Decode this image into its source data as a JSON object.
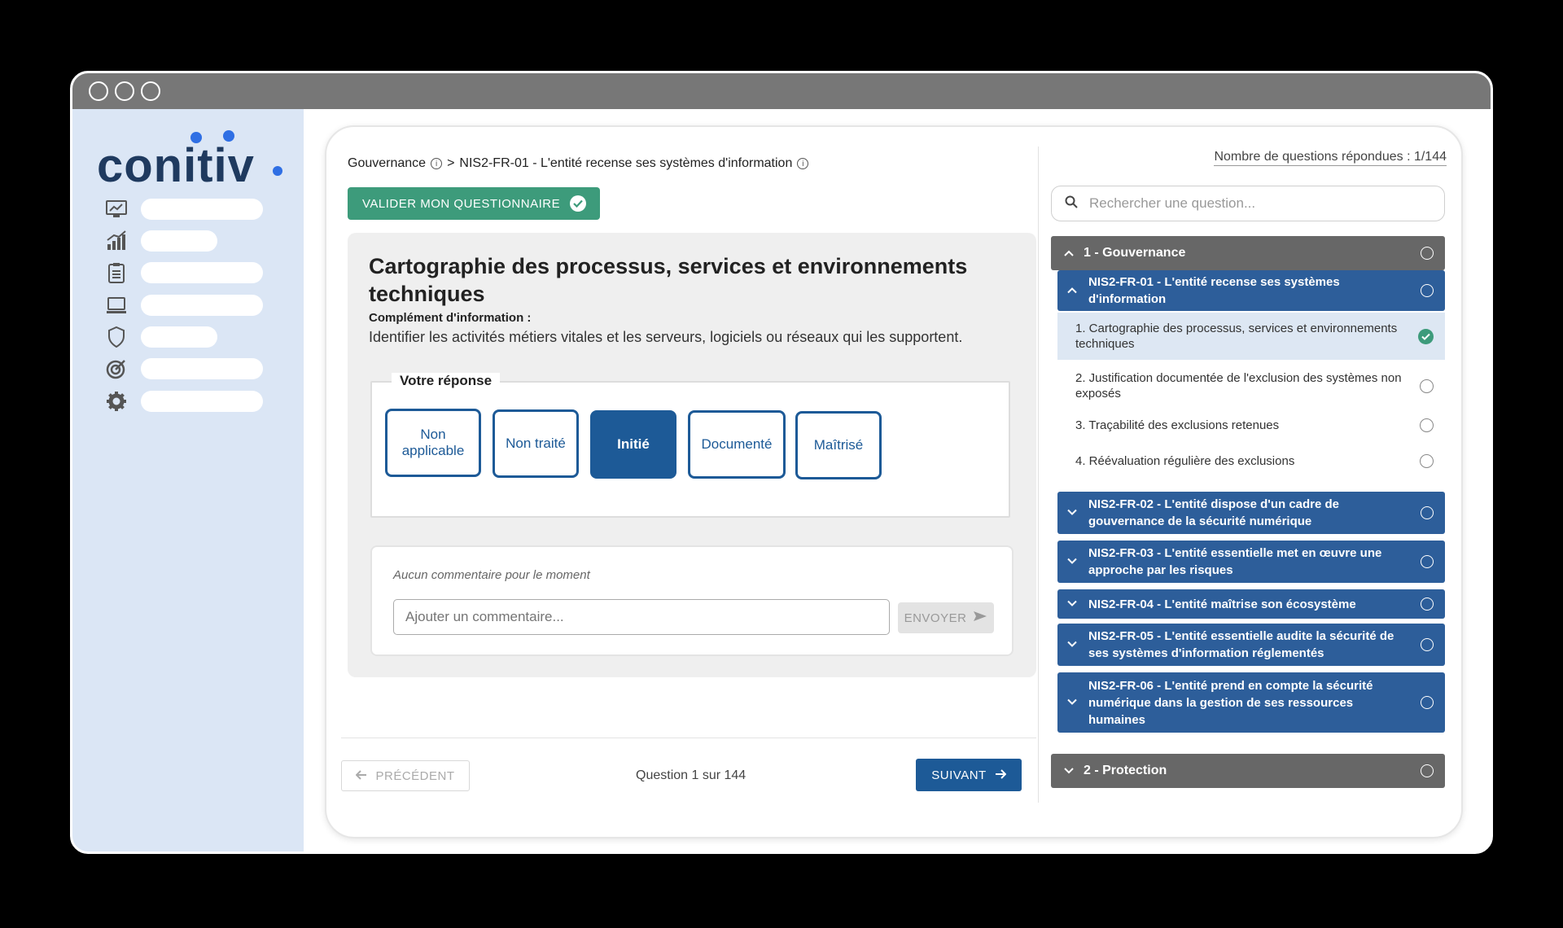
{
  "logo": {
    "text": "conitiv"
  },
  "sidebar": {
    "items": [
      {
        "icon": "monitor-chart-icon"
      },
      {
        "icon": "bar-chart-icon"
      },
      {
        "icon": "clipboard-icon"
      },
      {
        "icon": "laptop-icon"
      },
      {
        "icon": "shield-icon"
      },
      {
        "icon": "target-icon"
      },
      {
        "icon": "gear-icon"
      }
    ]
  },
  "breadcrumb": {
    "section": "Gouvernance",
    "separator": ">",
    "current": "NIS2-FR-01 - L'entité recense ses systèmes d'information"
  },
  "toolbar": {
    "validate_label": "VALIDER MON QUESTIONNAIRE"
  },
  "question": {
    "title": "Cartographie des processus, services et environnements techniques",
    "subtitle": "Complément d'information :",
    "description": "Identifier les activités métiers vitales et les serveurs, logiciels ou réseaux qui les supportent."
  },
  "answer": {
    "legend": "Votre réponse",
    "options": [
      "Non applicable",
      "Non traité",
      "Initié",
      "Documenté",
      "Maîtrisé"
    ],
    "selected": "Initié"
  },
  "comments": {
    "empty_text": "Aucun commentaire pour le moment",
    "placeholder": "Ajouter un commentaire...",
    "send_label": "ENVOYER"
  },
  "footer": {
    "prev_label": "PRÉCÉDENT",
    "counter": "Question 1 sur 144",
    "next_label": "SUIVANT"
  },
  "right_panel": {
    "answered": "Nombre de questions répondues : 1/144",
    "search_placeholder": "Rechercher une question...",
    "sections": [
      {
        "label": "1 - Gouvernance",
        "expanded": true,
        "subsections": [
          {
            "label": "NIS2-FR-01 - L'entité recense ses systèmes d'information",
            "expanded": true,
            "questions": [
              {
                "label": "1. Cartographie des processus, services et environnements techniques",
                "done": true
              },
              {
                "label": "2. Justification documentée de l'exclusion des systèmes non exposés",
                "done": false
              },
              {
                "label": "3. Traçabilité des exclusions retenues",
                "done": false
              },
              {
                "label": "4. Réévaluation régulière des exclusions",
                "done": false
              }
            ]
          },
          {
            "label": "NIS2-FR-02 - L'entité dispose d'un cadre de gouvernance de la sécurité numérique"
          },
          {
            "label": "NIS2-FR-03 - L'entité essentielle met en œuvre une approche par les risques"
          },
          {
            "label": "NIS2-FR-04 - L'entité maîtrise son écosystème"
          },
          {
            "label": "NIS2-FR-05 - L'entité essentielle audite la sécurité de ses systèmes d'information réglementés"
          },
          {
            "label": "NIS2-FR-06 - L'entité prend en compte la sécurité numérique dans la gestion de ses ressources humaines"
          }
        ]
      },
      {
        "label": "2 - Protection",
        "expanded": false
      }
    ]
  },
  "colors": {
    "primary": "#1d5a97",
    "accent_green": "#3d9b7b",
    "section_gray": "#676767",
    "sidebar_bg": "#dbe6f5"
  }
}
